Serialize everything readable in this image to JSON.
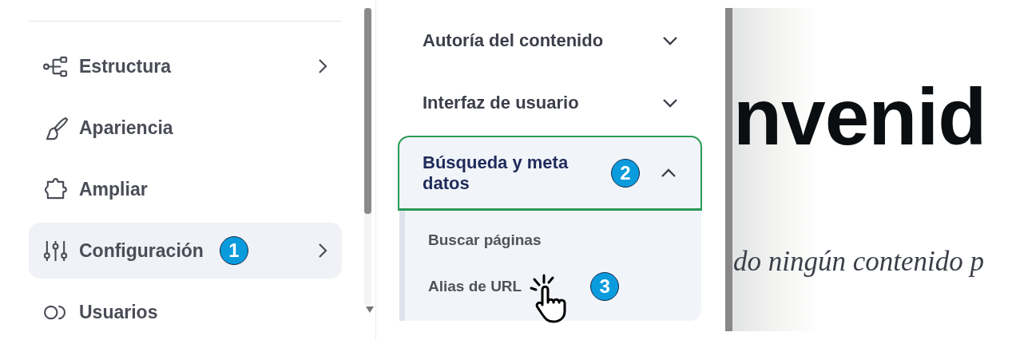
{
  "sidebar": {
    "items": [
      {
        "label": "Estructura",
        "kind": "structure",
        "has_children": true,
        "selected": false
      },
      {
        "label": "Apariencia",
        "kind": "brush",
        "has_children": false,
        "selected": false
      },
      {
        "label": "Ampliar",
        "kind": "puzzle",
        "has_children": false,
        "selected": false
      },
      {
        "label": "Configuración",
        "kind": "sliders",
        "has_children": true,
        "selected": true,
        "step": "1"
      },
      {
        "label": "Usuarios",
        "kind": "users",
        "has_children": false,
        "selected": false
      }
    ]
  },
  "submenu": {
    "items": [
      {
        "label": "Autoría del contenido",
        "expanded": false,
        "highlighted": false
      },
      {
        "label": "Interfaz de usuario",
        "expanded": false,
        "highlighted": false
      },
      {
        "label": "Búsqueda y meta datos",
        "expanded": true,
        "highlighted": true,
        "step": "2",
        "children": [
          {
            "label": "Buscar páginas",
            "cursor": false
          },
          {
            "label": "Alias de URL",
            "step": "3",
            "cursor": true
          }
        ]
      }
    ]
  },
  "content": {
    "heading": "nvenid",
    "text": "do ningún contenido p"
  }
}
